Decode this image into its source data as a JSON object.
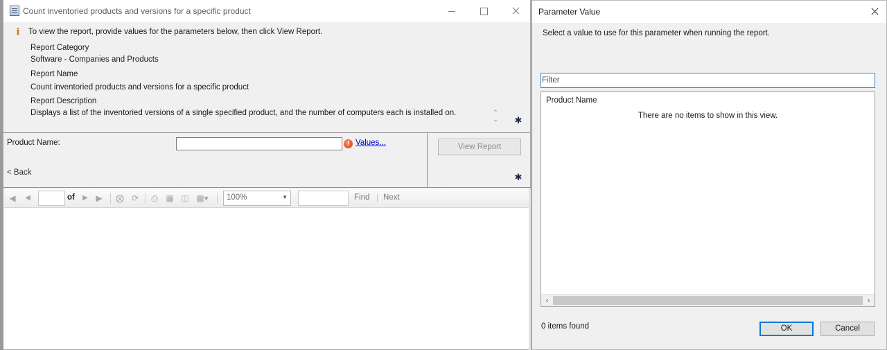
{
  "report_window": {
    "title": "Count inventoried products and versions for a specific product",
    "info_message": "To view the report, provide values for the parameters below, then click View Report.",
    "category_label": "Report Category",
    "category_value": "Software - Companies and Products",
    "name_label": "Report Name",
    "name_value": "Count inventoried products and versions for a specific product",
    "description_label": "Report Description",
    "description_value": "Displays a list of the inventoried versions of a single specified product, and the number of computers each is installed on.",
    "parameter": {
      "label": "Product Name:",
      "value": "",
      "values_link": "Values..."
    },
    "back_label": "< Back",
    "view_report_label": "View Report",
    "toolbar": {
      "page_value": "",
      "of_label": "of",
      "zoom": "100%",
      "find_value": "",
      "find_label": "Find",
      "next_label": "Next"
    }
  },
  "dialog": {
    "title": "Parameter Value",
    "description": "Select a value to use for this parameter when running the report.",
    "filter_placeholder": "Filter",
    "column_header": "Product Name",
    "empty_message": "There are no items to show in this view.",
    "items_found": "0 items found",
    "ok_label": "OK",
    "cancel_label": "Cancel"
  },
  "colors": {
    "link": "#0000cc",
    "focus_border": "#0078d7",
    "warning": "#d23a10"
  }
}
